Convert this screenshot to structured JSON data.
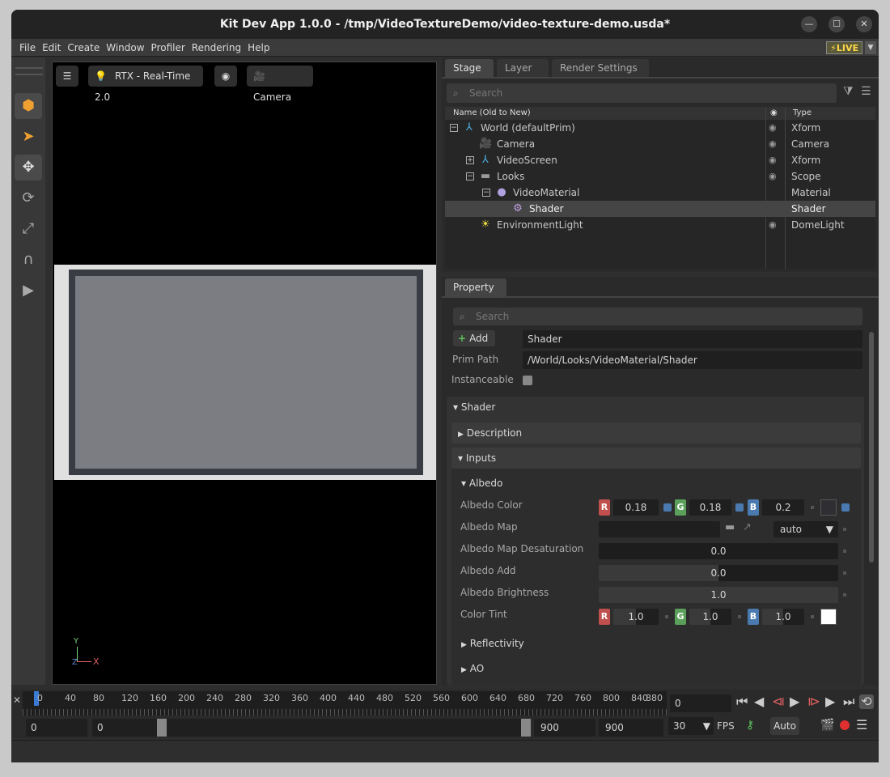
{
  "window": {
    "title": "Kit Dev App 1.0.0 - /tmp/VideoTextureDemo/video-texture-demo.usda*"
  },
  "menu": [
    "File",
    "Edit",
    "Create",
    "Window",
    "Profiler",
    "Rendering",
    "Help"
  ],
  "live_label": "LIVE",
  "viewport": {
    "renderer": "RTX - Real-Time 2.0",
    "camera": "Camera",
    "axis_y": "Y",
    "axis_x": "X",
    "axis_z": "Z"
  },
  "stage": {
    "tabs": [
      "Stage",
      "Layer",
      "Render Settings"
    ],
    "search_placeholder": "Search",
    "col_name": "Name (Old to New)",
    "col_type": "Type",
    "rows": [
      {
        "name": "World (defaultPrim)",
        "type": "Xform"
      },
      {
        "name": "Camera",
        "type": "Camera"
      },
      {
        "name": "VideoScreen",
        "type": "Xform"
      },
      {
        "name": "Looks",
        "type": "Scope"
      },
      {
        "name": "VideoMaterial",
        "type": "Material"
      },
      {
        "name": "Shader",
        "type": "Shader"
      },
      {
        "name": "EnvironmentLight",
        "type": "DomeLight"
      }
    ]
  },
  "property": {
    "tab": "Property",
    "search_placeholder": "Search",
    "add_label": "Add",
    "prim_name": "Shader",
    "prim_path_label": "Prim Path",
    "prim_path": "/World/Looks/VideoMaterial/Shader",
    "instanceable_label": "Instanceable",
    "section_shader": "Shader",
    "section_description": "Description",
    "section_inputs": "Inputs",
    "section_albedo": "Albedo",
    "albedo_color_label": "Albedo Color",
    "albedo_color": {
      "r": "0.18",
      "g": "0.18",
      "b": "0.2"
    },
    "albedo_map_label": "Albedo Map",
    "albedo_map_mode": "auto",
    "albedo_map_desat_label": "Albedo Map Desaturation",
    "albedo_map_desat": "0.0",
    "albedo_add_label": "Albedo Add",
    "albedo_add": "0.0",
    "albedo_brightness_label": "Albedo Brightness",
    "albedo_brightness": "1.0",
    "color_tint_label": "Color Tint",
    "color_tint": {
      "r": "1.0",
      "g": "1.0",
      "b": "1.0"
    },
    "section_reflectivity": "Reflectivity",
    "section_ao": "AO",
    "channel_r": "R",
    "channel_g": "G",
    "channel_b": "B"
  },
  "timeline": {
    "ticks": [
      "0",
      "40",
      "80",
      "120",
      "160",
      "200",
      "240",
      "280",
      "320",
      "360",
      "400",
      "440",
      "480",
      "520",
      "560",
      "600",
      "640",
      "680",
      "720",
      "760",
      "800",
      "840",
      "880"
    ],
    "current_frame": "0",
    "start": "0",
    "range_start": "0",
    "range_end": "900",
    "end": "900",
    "fps": "30",
    "fps_label": "FPS",
    "auto_label": "Auto"
  },
  "colors": {
    "r": "#c0504d",
    "g": "#5aa05a",
    "b": "#4a7ab0",
    "accent": "#ffd84a"
  }
}
